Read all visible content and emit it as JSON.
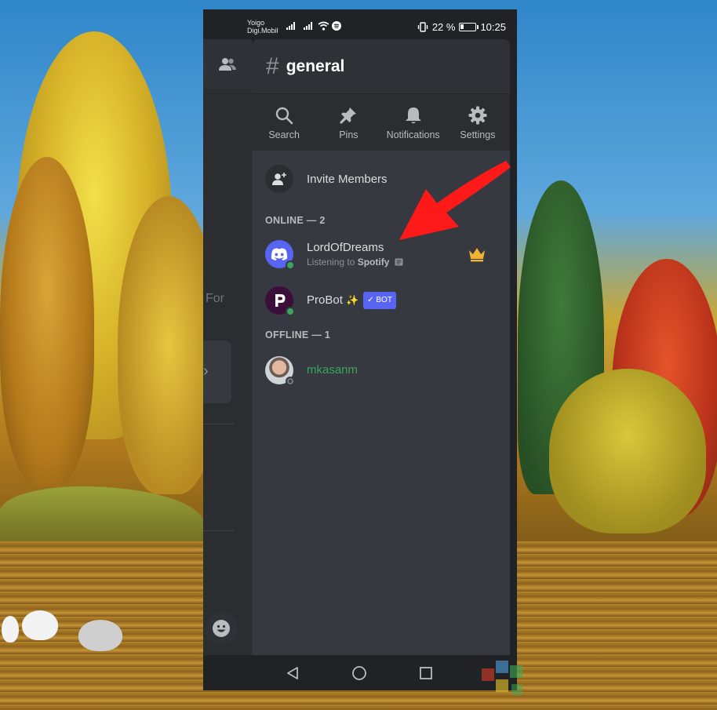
{
  "status_bar": {
    "carrier_1": "Yoigo",
    "carrier_2": "Digi.Mobil",
    "battery_percent": "22 %",
    "battery_level": 0.22,
    "time": "10:25"
  },
  "left_panel": {
    "partial_text": "For"
  },
  "channel": {
    "hash": "#",
    "name": "general"
  },
  "toolbar": {
    "items": [
      {
        "label": "Search",
        "icon": "search-icon"
      },
      {
        "label": "Pins",
        "icon": "pin-icon"
      },
      {
        "label": "Notifications",
        "icon": "bell-icon"
      },
      {
        "label": "Settings",
        "icon": "gear-icon"
      }
    ]
  },
  "members_panel": {
    "invite_label": "Invite Members",
    "online_header": "ONLINE — 2",
    "offline_header": "OFFLINE — 1",
    "online": [
      {
        "name": "LordOfDreams",
        "status_prefix": "Listening to ",
        "status_app": "Spotify",
        "owner": true,
        "avatar_color": "#5865f2"
      },
      {
        "name": "ProBot",
        "sparkle": "✨",
        "bot_tag": "✓ BOT",
        "avatar_color": "#3b0f3a"
      }
    ],
    "offline": [
      {
        "name": "mkasanm",
        "name_color": "#3ba55d"
      }
    ]
  },
  "colors": {
    "accent": "#5865f2",
    "online": "#3ba55d",
    "crown": "#f0b232",
    "arrow": "#ff1a1a"
  }
}
